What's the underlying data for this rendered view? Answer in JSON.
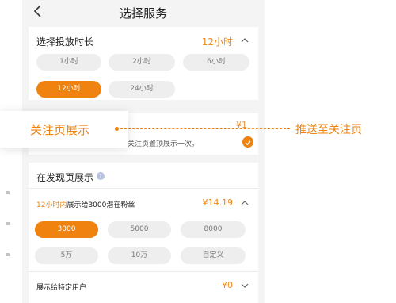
{
  "nav": {
    "title": "选择服务"
  },
  "duration": {
    "label": "选择投放时长",
    "selected_value": "12小时",
    "options": [
      "1小时",
      "2小时",
      "6小时",
      "12小时",
      "24小时"
    ]
  },
  "follow_page": {
    "price_partial": "¥1",
    "desc_partial": "的关注页置顶展示一次。",
    "checked": true
  },
  "discover": {
    "section_label": "在发现页展示",
    "summary_highlight": "12小时内",
    "summary_rest": "展示给3000潜在粉丝",
    "price": "¥14.19",
    "options": [
      "3000",
      "5000",
      "8000",
      "5万",
      "10万",
      "自定义"
    ],
    "selected": "3000"
  },
  "specific_users": {
    "label": "展示给特定用户",
    "price": "¥0"
  },
  "annotation": {
    "callout_label": "关注页展示",
    "right_label": "推送至关注页"
  },
  "colors": {
    "accent": "#f0820f",
    "chip_bg": "#eeeeee",
    "page_bg": "#f4f4f4"
  }
}
